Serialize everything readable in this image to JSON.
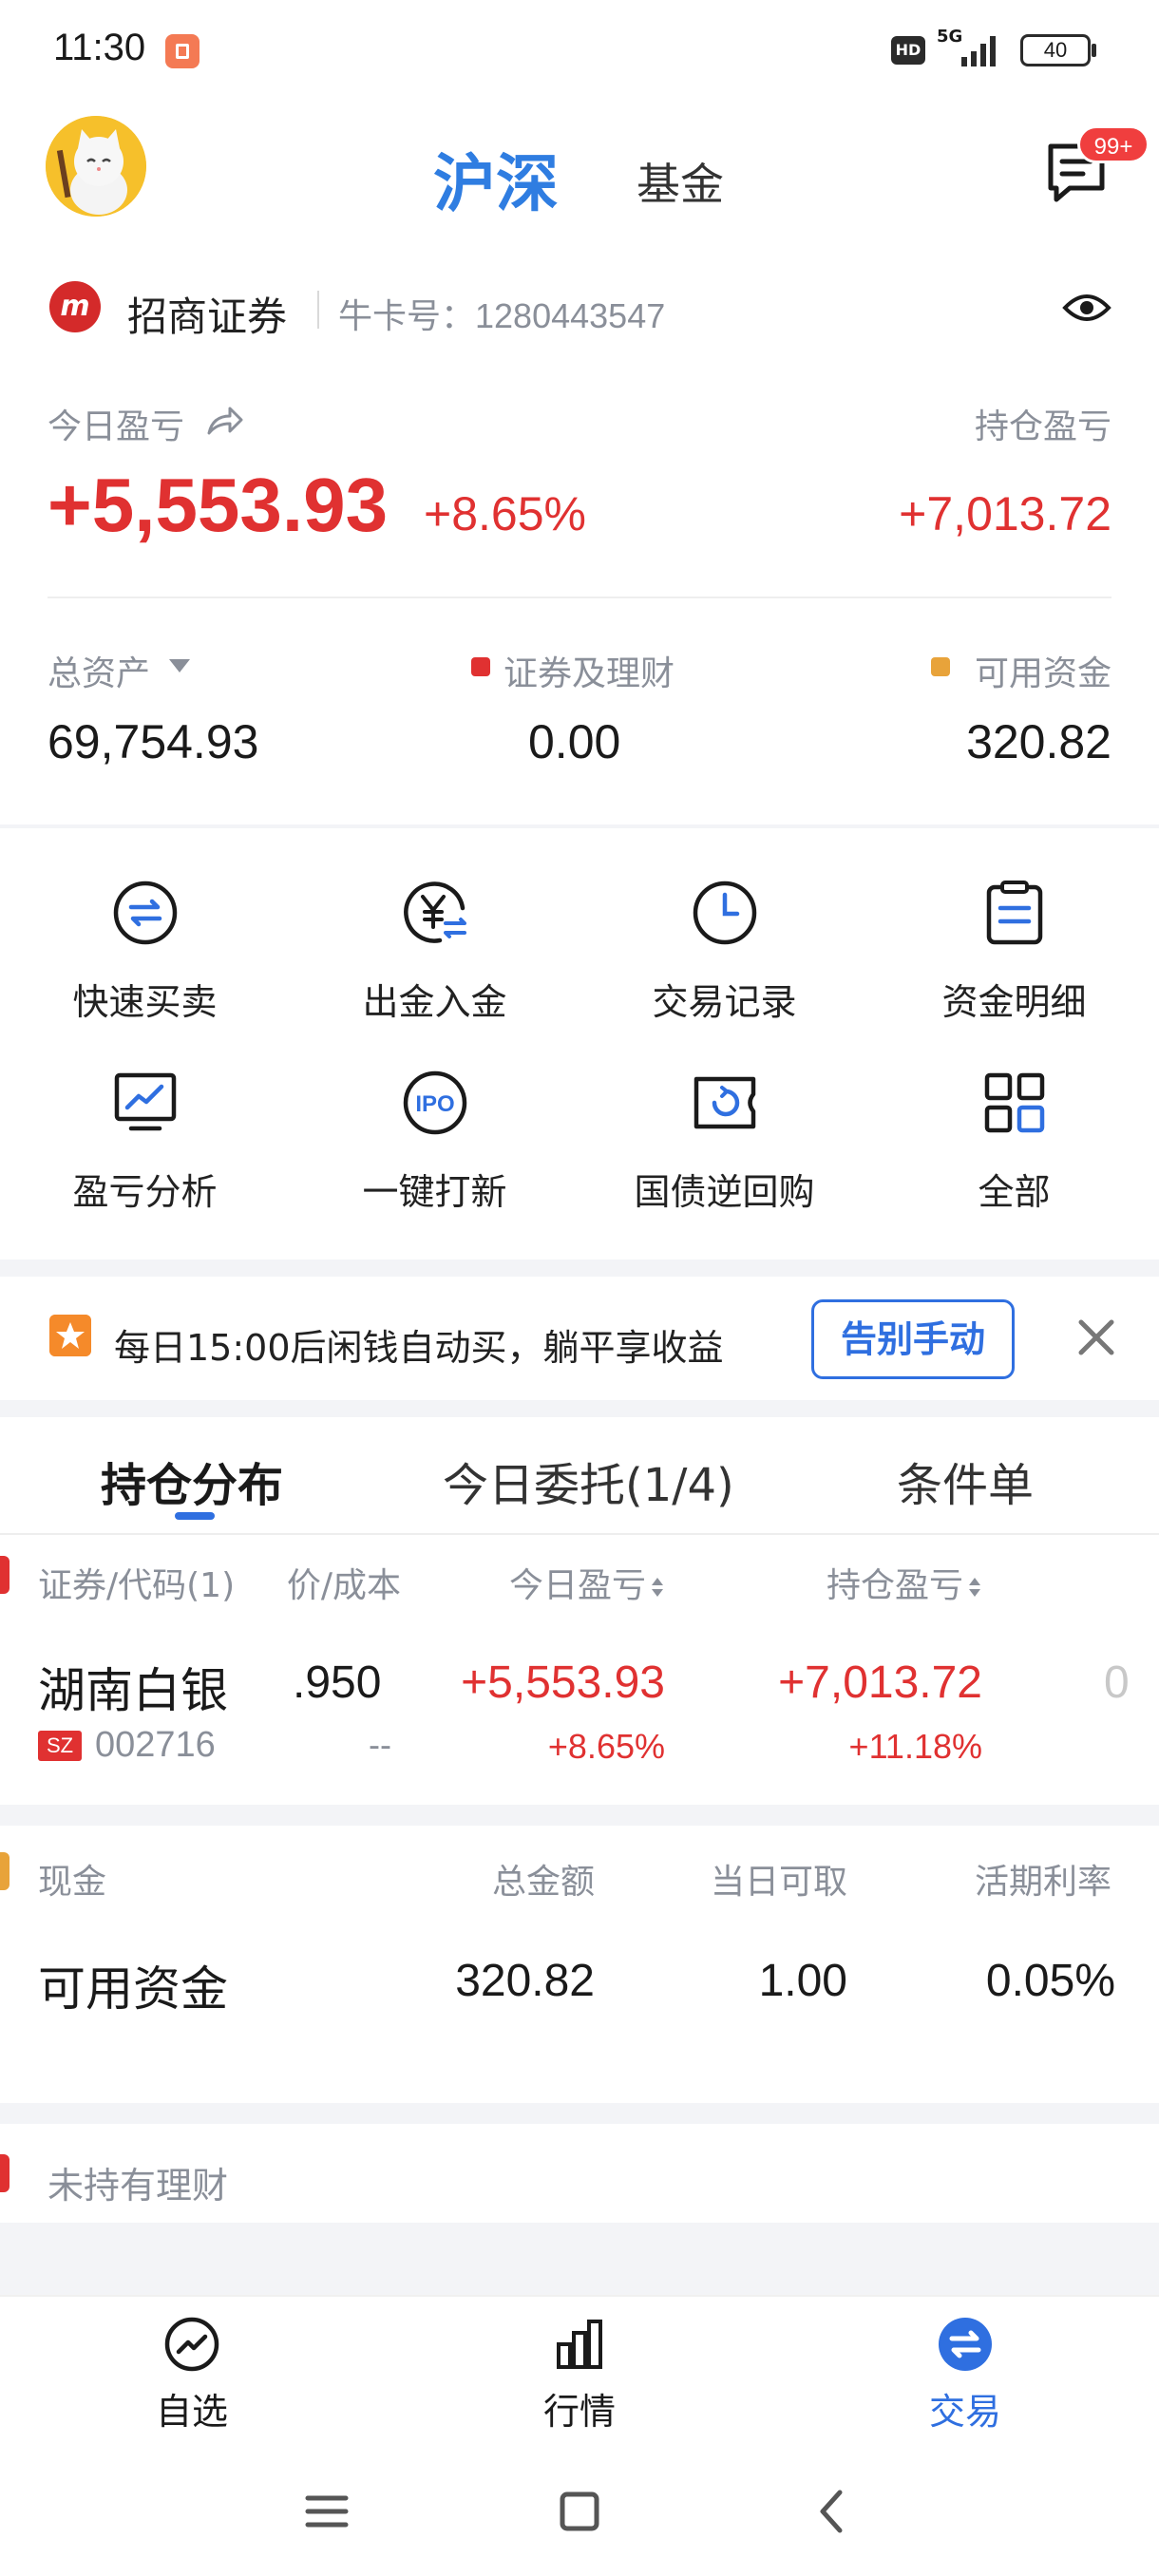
{
  "status_bar": {
    "time": "11:30",
    "hd": "HD",
    "network": "5G",
    "battery": "40"
  },
  "header": {
    "tabs": [
      "沪深",
      "基金"
    ],
    "message_badge": "99+"
  },
  "account": {
    "broker_name": "招商证券",
    "broker_logo": "m",
    "card_label": "牛卡号：",
    "card_no": "1280443547"
  },
  "summary": {
    "today_label": "今日盈亏",
    "today_pl": "+5,553.93",
    "today_pct": "+8.65%",
    "hold_label": "持仓盈亏",
    "hold_pl": "+7,013.72",
    "total_label": "总资产",
    "total_value": "69,754.93",
    "securities_label": "证券及理财",
    "securities_value": "0.00",
    "available_label": "可用资金",
    "available_value": "320.82"
  },
  "quick_actions": [
    {
      "label": "快速买卖",
      "icon": "swap-icon"
    },
    {
      "label": "出金入金",
      "icon": "yuan-transfer-icon"
    },
    {
      "label": "交易记录",
      "icon": "clock-icon"
    },
    {
      "label": "资金明细",
      "icon": "clipboard-icon"
    },
    {
      "label": "盈亏分析",
      "icon": "chart-monitor-icon"
    },
    {
      "label": "一键打新",
      "icon": "ipo-icon"
    },
    {
      "label": "国债逆回购",
      "icon": "repo-ticket-icon"
    },
    {
      "label": "全部",
      "icon": "grid-icon"
    }
  ],
  "promo": {
    "text": "每日15:00后闲钱自动买，躺平享收益",
    "button": "告别手动"
  },
  "position_tabs": [
    "持仓分布",
    "今日委托(1/4)",
    "条件单"
  ],
  "position_table": {
    "headers": [
      "证券/代码(1)",
      "价/成本",
      "今日盈亏",
      "持仓盈亏"
    ],
    "rows": [
      {
        "name": "湖南白银",
        "market": "SZ",
        "code": "002716",
        "price": ".950",
        "cost": "--",
        "today_pl": "+5,553.93",
        "today_pct": "+8.65%",
        "hold_pl": "+7,013.72",
        "hold_pct": "+11.18%",
        "overflow": "0"
      }
    ]
  },
  "cash_table": {
    "headers": [
      "现金",
      "总金额",
      "当日可取",
      "活期利率"
    ],
    "row": {
      "name": "可用资金",
      "total": "320.82",
      "withdrawable": "1.00",
      "rate": "0.05%"
    }
  },
  "no_finance_label": "未持有理财",
  "bottom_nav": [
    {
      "label": "自选",
      "active": false
    },
    {
      "label": "行情",
      "active": false
    },
    {
      "label": "交易",
      "active": true
    }
  ],
  "colors": {
    "accent": "#2f6fe0",
    "up": "#e03131",
    "muted": "#8a8f99"
  }
}
